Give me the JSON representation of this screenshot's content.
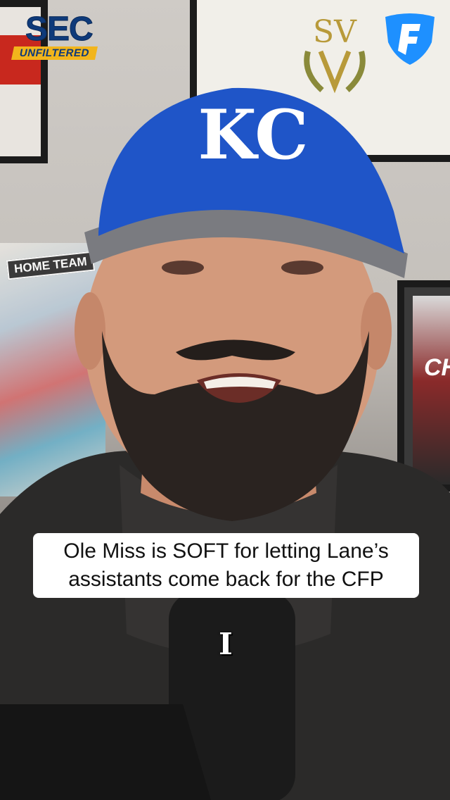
{
  "brand": {
    "name_top": "SEC",
    "name_bottom": "UNFILTERED",
    "top_color": "#0e3a7a",
    "bar_color": "#f2b51c"
  },
  "sponsor": {
    "icon": "fanduel-shield-icon",
    "color": "#1e90ff"
  },
  "background": {
    "poster_text": "HOME TEAM",
    "poster_right_text": "CH",
    "wall_logo_text": "SV",
    "cap_logo_text": "KC",
    "cap_color": "#1f55c8"
  },
  "caption": {
    "line1": "Ole Miss is SOFT for letting Lane’s",
    "line2": "assistants come back for the CFP"
  },
  "subtitle_word": "I"
}
